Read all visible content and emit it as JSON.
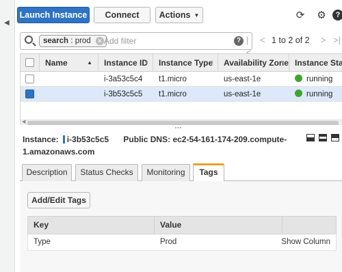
{
  "toolbar": {
    "launch_label": "Launch Instance",
    "connect_label": "Connect",
    "actions_label": "Actions"
  },
  "search": {
    "chip_key": "search",
    "chip_sep": ":",
    "chip_value": "prod",
    "placeholder": "Add filter"
  },
  "pager": {
    "text": "1 to 2 of 2"
  },
  "table": {
    "columns": [
      "Name",
      "Instance ID",
      "Instance Type",
      "Availability Zone",
      "Instance State"
    ],
    "rows": [
      {
        "name": "",
        "instance_id": "i-3a53c5c4",
        "instance_type": "t1.micro",
        "zone": "us-east-1e",
        "state": "running",
        "selected": false
      },
      {
        "name": "",
        "instance_id": "i-3b53c5c5",
        "instance_type": "t1.micro",
        "zone": "us-east-1e",
        "state": "running",
        "selected": true
      }
    ]
  },
  "details": {
    "instance_label": "Instance:",
    "instance_id": "i-3b53c5c5",
    "dns_label": "Public DNS:",
    "dns_value": "ec2-54-161-174-209.compute-",
    "dns_value_cont": "1.amazonaws.com"
  },
  "tabs": [
    "Description",
    "Status Checks",
    "Monitoring",
    "Tags"
  ],
  "active_tab": "Tags",
  "tags": {
    "button_label": "Add/Edit Tags",
    "columns": [
      "Key",
      "Value"
    ],
    "rows": [
      {
        "key": "Type",
        "value": "Prod"
      }
    ],
    "show_column_label": "Show Column"
  },
  "colors": {
    "primary": "#2e73c4",
    "running": "#3ea52f",
    "active_tab_accent": "#f0a020",
    "selected_row": "#dde9f8"
  }
}
